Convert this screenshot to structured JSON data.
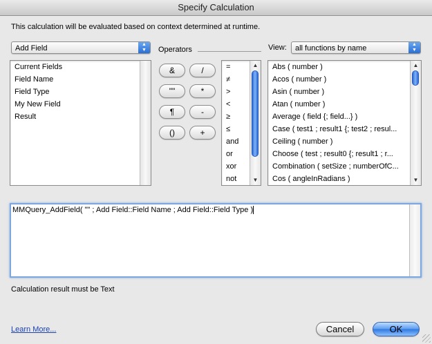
{
  "window": {
    "title": "Specify Calculation"
  },
  "description": "This calculation will be evaluated based on context determined at runtime.",
  "table_popup": {
    "selected": "Add Field"
  },
  "fields_list": {
    "items": [
      "Current Fields",
      "Field Name",
      "Field Type",
      "My New Field",
      "Result"
    ]
  },
  "operators": {
    "label": "Operators",
    "buttons": [
      "&",
      "/",
      "\"\"",
      "*",
      "¶",
      "-",
      "()",
      "+"
    ],
    "list": [
      "=",
      "≠",
      ">",
      "<",
      "≥",
      "≤",
      "and",
      "or",
      "xor",
      "not"
    ]
  },
  "view": {
    "label": "View:",
    "selected": "all functions by name",
    "functions": [
      "Abs ( number )",
      "Acos ( number )",
      "Asin ( number )",
      "Atan ( number )",
      "Average ( field {; field...} )",
      "Case ( test1 ; result1 {; test2 ; resul...",
      "Ceiling ( number )",
      "Choose ( test ; result0 {; result1 ; r...",
      "Combination ( setSize ; numberOfC...",
      "Cos ( angleInRadians )"
    ]
  },
  "calculation": {
    "text": "MMQuery_AddField( \"\" ; Add Field::Field Name ; Add Field::Field Type )"
  },
  "result_type": "Calculation result must be Text",
  "learn_more": "Learn More...",
  "buttons": {
    "cancel": "Cancel",
    "ok": "OK"
  }
}
